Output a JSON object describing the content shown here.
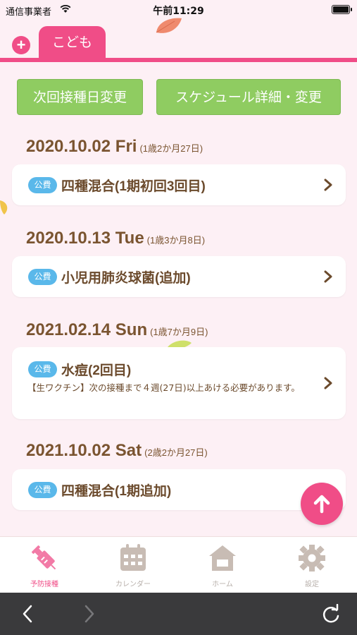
{
  "status_bar": {
    "carrier": "通信事業者",
    "time": "午前11:29"
  },
  "header": {
    "add_icon": "plus-icon",
    "child_tab": "こども"
  },
  "actions": {
    "next_date_change": "次回接種日変更",
    "schedule_detail": "スケジュール詳細・変更"
  },
  "schedule": [
    {
      "date": "2020.10.02 Fri",
      "age": "(1歳2か月27日)",
      "items": [
        {
          "badge": "公費",
          "name": "四種混合(1期初回3回目)",
          "note": ""
        }
      ]
    },
    {
      "date": "2020.10.13 Tue",
      "age": "(1歳3か月8日)",
      "items": [
        {
          "badge": "公費",
          "name": "小児用肺炎球菌(追加)",
          "note": ""
        }
      ]
    },
    {
      "date": "2021.02.14 Sun",
      "age": "(1歳7か月9日)",
      "items": [
        {
          "badge": "公費",
          "name": "水痘(2回目)",
          "note": "【生ワクチン】次の接種まで４週(27日)以上あける必要があります。"
        }
      ]
    },
    {
      "date": "2021.10.02 Sat",
      "age": "(2歳2か月27日)",
      "items": [
        {
          "badge": "公費",
          "name": "四種混合(1期追加)",
          "note": ""
        }
      ]
    }
  ],
  "bottom_nav": [
    {
      "label": "予防接種",
      "icon": "syringe-icon",
      "active": true
    },
    {
      "label": "カレンダー",
      "icon": "calendar-icon",
      "active": false
    },
    {
      "label": "ホーム",
      "icon": "house-icon",
      "active": false
    },
    {
      "label": "設定",
      "icon": "gear-icon",
      "active": false
    }
  ],
  "browser": {
    "back_icon": "chevron-left-icon",
    "forward_icon": "chevron-right-icon",
    "reload_icon": "reload-icon"
  },
  "colors": {
    "accent": "#f04d87",
    "action_green": "#8fcc61",
    "badge_blue": "#5ab8ea",
    "text_brown": "#7a5430",
    "background": "#fdf0f5"
  }
}
